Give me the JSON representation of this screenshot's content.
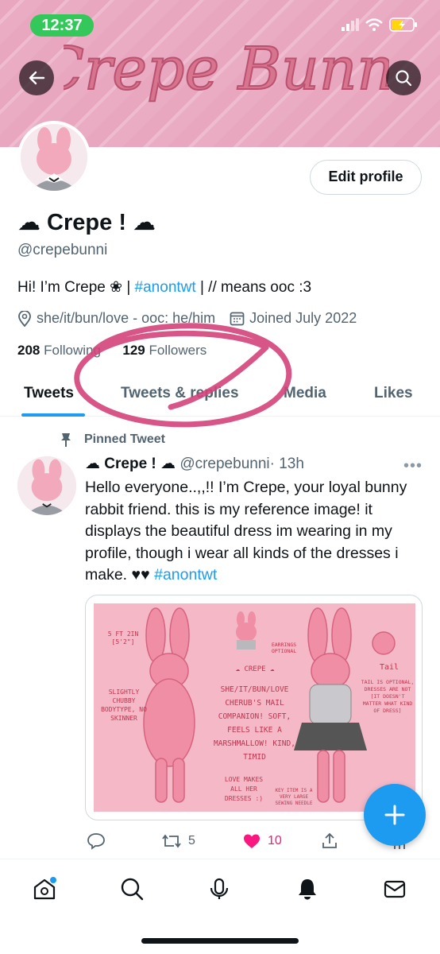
{
  "status_bar": {
    "time": "12:37"
  },
  "banner": {
    "title": "Crepe Bunni"
  },
  "profile": {
    "edit_button": "Edit profile",
    "display_name": "☁ Crepe ! ☁",
    "handle": "@crepebunni",
    "bio_prefix": "Hi! I’m Crepe ❀ | ",
    "bio_link": "#anontwt",
    "bio_suffix": " | // means ooc :3",
    "pronouns": "she/it/bun/love - ooc: he/him",
    "joined": "Joined July 2022",
    "following_count": "208",
    "following_label": "Following",
    "followers_count": "129",
    "followers_label": "Followers"
  },
  "tabs": [
    {
      "label": "Tweets"
    },
    {
      "label": "Tweets & replies"
    },
    {
      "label": "Media"
    },
    {
      "label": "Likes"
    }
  ],
  "tweet": {
    "pinned_label": "Pinned Tweet",
    "name": "☁ Crepe ! ☁",
    "handle": "@crepebunni",
    "time": "· 13h",
    "text": "Hello everyone..,,!! I’m Crepe, your loyal bunny rabbit friend. this is my reference image! it displays the beautiful dress im wearing in my profile, though i wear all kinds of the dresses i make. ♥♥ ",
    "hashtag": "#anontwt",
    "retweets": "5",
    "likes": "10",
    "image_texts": {
      "height": "5 FT 2IN [5'2\"]",
      "earrings": "EARRINGS OPTIONAL",
      "name": "☁ CREPE ☁",
      "desc": "SHE/IT/BUN/LOVE CHERUB'S MAIL COMPANION! SOFT, FEELS LIKE A MARSHMALLOW! KIND, TIMID",
      "body": "SLIGHTLY CHUBBY BODYTYPE, NO SKINNER",
      "tail": "Tail",
      "tail_note": "TAIL IS OPTIONAL, DRESSES ARE NOT [IT DOESN'T MATTER WHAT KIND OF DRESS]",
      "love": "LOVE MAKES ALL HER DRESSES :)",
      "key": "KEY ITEM IS A VERY LARGE SEWING NEEDLE"
    }
  },
  "colors": {
    "accent": "#1d9bf0",
    "like": "#f91880",
    "banner_pink": "#e8a7bf",
    "annotation": "#d4427a"
  }
}
